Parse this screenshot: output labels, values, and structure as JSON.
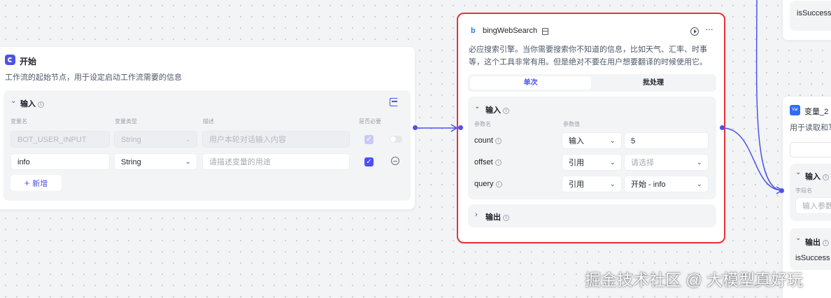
{
  "start_node": {
    "title": "开始",
    "description": "工作流的起始节点，用于设定启动工作流需要的信息",
    "input_section": {
      "title": "输入",
      "col_var_name": "变量名",
      "col_var_type": "变量类型",
      "col_desc": "描述",
      "col_required": "是否必要",
      "rows": [
        {
          "name": "BOT_USER_INPUT",
          "type": "String",
          "desc_placeholder": "用户本轮对话输入内容",
          "required": true,
          "disabled": true
        },
        {
          "name": "info",
          "type": "String",
          "desc_placeholder": "请描述变量的用途",
          "required": true,
          "disabled": false
        }
      ],
      "add_label": "新增"
    }
  },
  "bing_node": {
    "title": "bingWebSearch",
    "description_line1": "必应搜索引擎。当你需要搜索你不知道的信息，比如天气、汇率、时事",
    "description_line2": "等，这个工具非常有用。但是绝对不要在用户想要翻译的时候使用它。",
    "tabs": [
      {
        "label": "单次",
        "active": true
      },
      {
        "label": "批处理",
        "active": false
      }
    ],
    "input_section": {
      "title": "输入",
      "col_param_name": "参数名",
      "col_param_value": "参数值",
      "rows": [
        {
          "name": "count",
          "mode": "输入",
          "value": "5",
          "is_placeholder": false
        },
        {
          "name": "offset",
          "mode": "引用",
          "value": "请选择",
          "is_placeholder": true
        },
        {
          "name": "query",
          "mode": "引用",
          "value": "开始 - info",
          "is_placeholder": false
        }
      ]
    },
    "output_section": {
      "title": "输出"
    }
  },
  "var_node": {
    "badge": "Var",
    "title": "变量_2",
    "description": "用于读取和写",
    "input_title": "输入",
    "field_name_label": "字段名",
    "field_placeholder": "输入参数",
    "output_title": "输出",
    "output_value": "isSuccess"
  },
  "top_right_node": {
    "value": "isSuccess"
  },
  "watermark": "掘金技术社区 @ 大模型真好玩",
  "colors": {
    "accent": "#4d53e8",
    "selection": "#e8323c",
    "canvas": "#f3f4f6"
  }
}
